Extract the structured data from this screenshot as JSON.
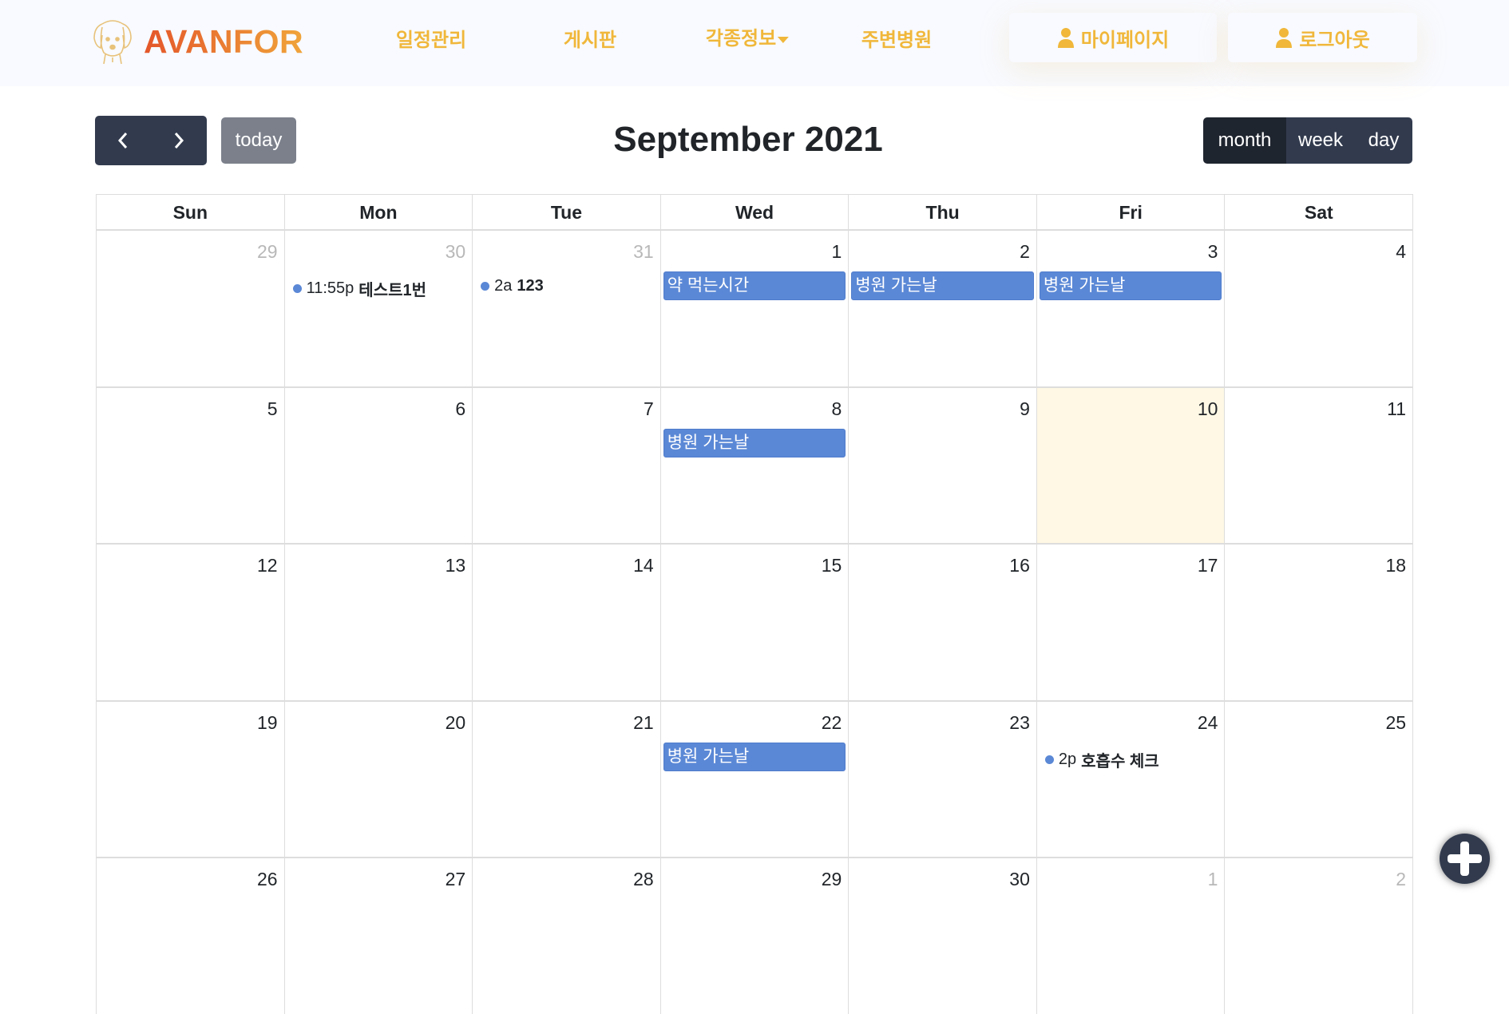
{
  "header": {
    "logo": "AVANFOR",
    "nav": [
      {
        "label": "일정관리"
      },
      {
        "label": "게시판"
      },
      {
        "label": "각종정보"
      },
      {
        "label": "주변병원"
      }
    ],
    "mypage": "마이페이지",
    "logout": "로그아웃"
  },
  "toolbar": {
    "today": "today",
    "title": "September 2021",
    "views": [
      "month",
      "week",
      "day"
    ]
  },
  "colors": {
    "accent": "#f0b73a",
    "event": "#5b88d6",
    "dark": "#323b4e",
    "today_bg": "#fef8e4"
  },
  "calendar": {
    "weekdays": [
      "Sun",
      "Mon",
      "Tue",
      "Wed",
      "Thu",
      "Fri",
      "Sat"
    ],
    "weeks": [
      [
        {
          "n": "29",
          "other": true
        },
        {
          "n": "30",
          "other": true,
          "events": [
            {
              "type": "dot",
              "time": "11:55p",
              "title": "테스트1번"
            }
          ]
        },
        {
          "n": "31",
          "other": true,
          "events": [
            {
              "type": "dot",
              "time": "2a",
              "title": "123"
            }
          ]
        },
        {
          "n": "1",
          "events": [
            {
              "type": "bar",
              "title": "약 먹는시간"
            }
          ]
        },
        {
          "n": "2",
          "events": [
            {
              "type": "bar",
              "title": "병원 가는날"
            }
          ]
        },
        {
          "n": "3",
          "events": [
            {
              "type": "bar",
              "title": "병원 가는날"
            }
          ]
        },
        {
          "n": "4"
        }
      ],
      [
        {
          "n": "5"
        },
        {
          "n": "6"
        },
        {
          "n": "7"
        },
        {
          "n": "8",
          "events": [
            {
              "type": "bar",
              "title": "병원 가는날"
            }
          ]
        },
        {
          "n": "9"
        },
        {
          "n": "10",
          "today": true
        },
        {
          "n": "11"
        }
      ],
      [
        {
          "n": "12"
        },
        {
          "n": "13"
        },
        {
          "n": "14"
        },
        {
          "n": "15"
        },
        {
          "n": "16"
        },
        {
          "n": "17"
        },
        {
          "n": "18"
        }
      ],
      [
        {
          "n": "19"
        },
        {
          "n": "20"
        },
        {
          "n": "21"
        },
        {
          "n": "22",
          "events": [
            {
              "type": "bar",
              "title": "병원 가는날"
            }
          ]
        },
        {
          "n": "23"
        },
        {
          "n": "24",
          "events": [
            {
              "type": "dot",
              "time": "2p",
              "title": "호흡수 체크"
            }
          ]
        },
        {
          "n": "25"
        }
      ],
      [
        {
          "n": "26"
        },
        {
          "n": "27"
        },
        {
          "n": "28"
        },
        {
          "n": "29"
        },
        {
          "n": "30"
        },
        {
          "n": "1",
          "other": true
        },
        {
          "n": "2",
          "other": true
        }
      ]
    ]
  }
}
